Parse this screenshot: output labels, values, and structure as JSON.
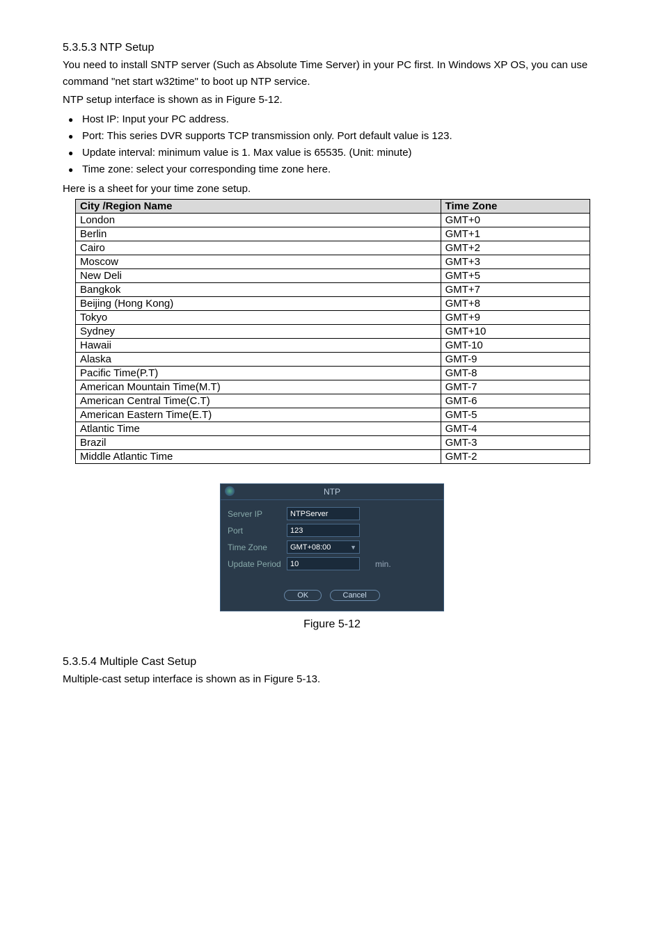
{
  "section1": {
    "heading": "5.3.5.3  NTP Setup",
    "para1": "You need to install SNTP server (Such as Absolute Time Server) in your PC first. In Windows XP OS, you can use command \"net start w32time\" to boot up NTP service.",
    "para2": "NTP setup interface is shown as in Figure 5-12.",
    "bullets": [
      "Host IP: Input your PC address.",
      "Port:  This series DVR supports TCP transmission only. Port default value is 123.",
      "Update interval: minimum value is 1. Max value is 65535. (Unit: minute)",
      "Time zone: select your corresponding time zone here."
    ],
    "sheet_intro": "Here is a sheet for your time zone setup."
  },
  "tz_table": {
    "headers": [
      "City /Region Name",
      "Time Zone"
    ],
    "rows": [
      [
        "London",
        "GMT+0"
      ],
      [
        "Berlin",
        "GMT+1"
      ],
      [
        "Cairo",
        "GMT+2"
      ],
      [
        "Moscow",
        "GMT+3"
      ],
      [
        "New Deli",
        "GMT+5"
      ],
      [
        "Bangkok",
        "GMT+7"
      ],
      [
        "Beijing (Hong Kong)",
        "GMT+8"
      ],
      [
        "Tokyo",
        "GMT+9"
      ],
      [
        "Sydney",
        "GMT+10"
      ],
      [
        "Hawaii",
        "GMT-10"
      ],
      [
        "Alaska",
        "GMT-9"
      ],
      [
        "Pacific Time(P.T)",
        "GMT-8"
      ],
      [
        "American  Mountain Time(M.T)",
        "GMT-7"
      ],
      [
        "American Central Time(C.T)",
        "GMT-6"
      ],
      [
        "American Eastern Time(E.T)",
        "GMT-5"
      ],
      [
        "Atlantic Time",
        "GMT-4"
      ],
      [
        "Brazil",
        "GMT-3"
      ],
      [
        "Middle Atlantic Time",
        "GMT-2"
      ]
    ]
  },
  "dialog": {
    "title": "NTP",
    "server_ip_label": "Server IP",
    "server_ip_value": "NTPServer",
    "port_label": "Port",
    "port_value": "123",
    "tz_label": "Time Zone",
    "tz_value": "GMT+08:00",
    "update_label": "Update Period",
    "update_value": "10",
    "update_unit": "min.",
    "ok": "OK",
    "cancel": "Cancel"
  },
  "figure_caption": "Figure 5-12",
  "section2": {
    "heading": "5.3.5.4  Multiple Cast Setup",
    "para1": "Multiple-cast setup interface is shown as in Figure 5-13."
  }
}
